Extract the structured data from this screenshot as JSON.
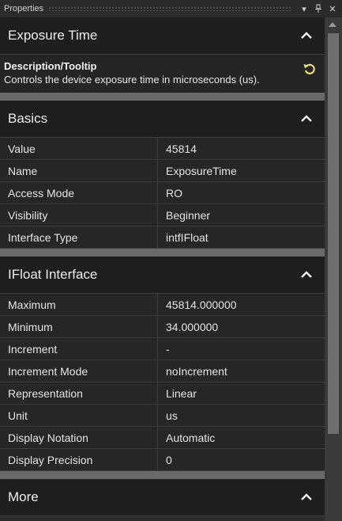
{
  "panel": {
    "title": "Properties",
    "dropdown_icon": "chevron-down-icon",
    "pin_icon": "pin-icon",
    "close_icon": "close-icon"
  },
  "sections": {
    "exposure": {
      "title": "Exposure Time",
      "description_title": "Description/Tooltip",
      "description_text": "Controls the device exposure time in microseconds (us)."
    },
    "basics": {
      "title": "Basics",
      "rows": [
        {
          "key": "Value",
          "value": "45814"
        },
        {
          "key": "Name",
          "value": "ExposureTime"
        },
        {
          "key": "Access Mode",
          "value": "RO"
        },
        {
          "key": "Visibility",
          "value": "Beginner"
        },
        {
          "key": "Interface Type",
          "value": "intfIFloat"
        }
      ]
    },
    "ifloat": {
      "title": "IFloat Interface",
      "rows": [
        {
          "key": "Maximum",
          "value": "45814.000000"
        },
        {
          "key": "Minimum",
          "value": "34.000000"
        },
        {
          "key": "Increment",
          "value": "-"
        },
        {
          "key": "Increment Mode",
          "value": "noIncrement"
        },
        {
          "key": "Representation",
          "value": "Linear"
        },
        {
          "key": "Unit",
          "value": "us"
        },
        {
          "key": "Display Notation",
          "value": "Automatic"
        },
        {
          "key": "Display Precision",
          "value": "0"
        }
      ]
    },
    "more": {
      "title": "More"
    }
  },
  "colors": {
    "background": "#2d2d2d",
    "header": "#1e1e1e",
    "reset_icon": "#e8e070"
  }
}
